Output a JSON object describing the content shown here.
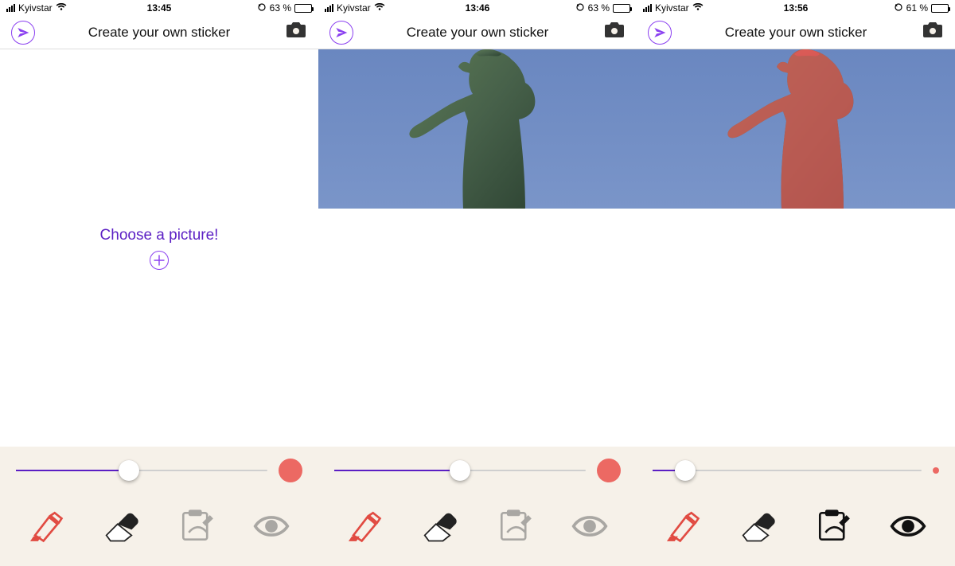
{
  "screens": [
    {
      "status": {
        "carrier": "Kyivstar",
        "time": "13:45",
        "battery_pct": "63 %",
        "battery_fill": 63
      },
      "nav": {
        "title": "Create your own sticker"
      },
      "state": "empty",
      "choose_label": "Choose a picture!",
      "slider": {
        "pct": 45,
        "dot_size": 30
      },
      "tools": {
        "marker_active": true,
        "eye_active": false
      }
    },
    {
      "status": {
        "carrier": "Kyivstar",
        "time": "13:46",
        "battery_pct": "63 %",
        "battery_fill": 63
      },
      "nav": {
        "title": "Create your own sticker"
      },
      "state": "image",
      "overlay": false,
      "slider": {
        "pct": 50,
        "dot_size": 30
      },
      "tools": {
        "marker_active": true,
        "eye_active": false
      }
    },
    {
      "status": {
        "carrier": "Kyivstar",
        "time": "13:56",
        "battery_pct": "61 %",
        "battery_fill": 61
      },
      "nav": {
        "title": "Create your own sticker"
      },
      "state": "image",
      "overlay": true,
      "slider": {
        "pct": 12,
        "dot_size": 8
      },
      "tools": {
        "marker_active": true,
        "eye_active": true
      }
    }
  ],
  "colors": {
    "accent": "#5b1fc4",
    "marker": "#e14b42",
    "brush_preview": "#ec6963",
    "toolbar_bg": "#f6f1e9"
  },
  "icons": {
    "send": "paper-plane",
    "camera": "camera",
    "add": "plus-circle",
    "marker": "highlighter",
    "eraser": "eraser",
    "clipboard": "clipboard-brush",
    "eye": "eye"
  }
}
